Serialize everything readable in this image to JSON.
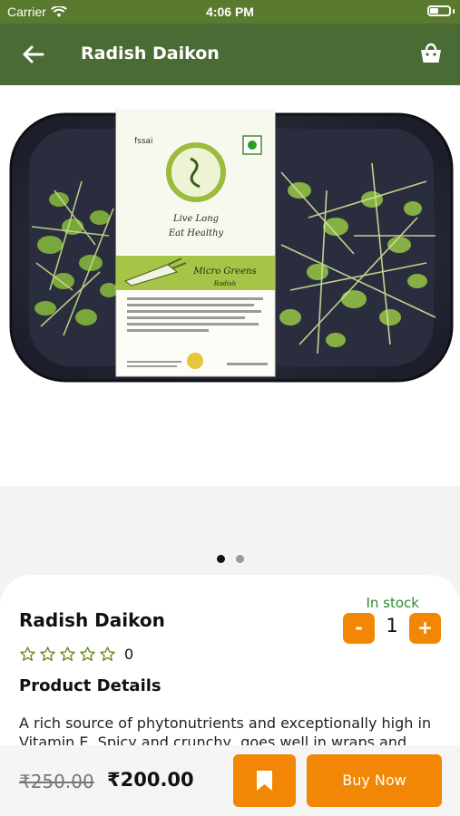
{
  "status_bar": {
    "carrier": "Carrier",
    "time": "4:06 PM"
  },
  "app_bar": {
    "title": "Radish Daikon"
  },
  "gallery": {
    "slide_count": 2,
    "active_slide": 1,
    "package_label": {
      "brand_mark": "fssai",
      "tagline_line1": "Live Long",
      "tagline_line2": "Eat Healthy",
      "product_type": "Micro Greens",
      "variety": "Radish"
    }
  },
  "product": {
    "name": "Radish Daikon",
    "stock_status": "In stock",
    "quantity": "1",
    "qty_minus_label": "-",
    "qty_plus_label": "+",
    "rating_count": "0",
    "stars_filled": 0,
    "stars_total": 5,
    "details_heading": "Product Details",
    "description": "A rich source of phytonutrients and exceptionally high in Vitamin E. Spicy and crunchy, goes well in wraps and"
  },
  "bottom_bar": {
    "old_price": "₹250.00",
    "price": "₹200.00",
    "buy_label": "Buy Now"
  },
  "colors": {
    "status_bar": "#5a7a2e",
    "app_bar": "#4a6b33",
    "accent": "#f28705",
    "stock_green": "#2d8a2d"
  }
}
